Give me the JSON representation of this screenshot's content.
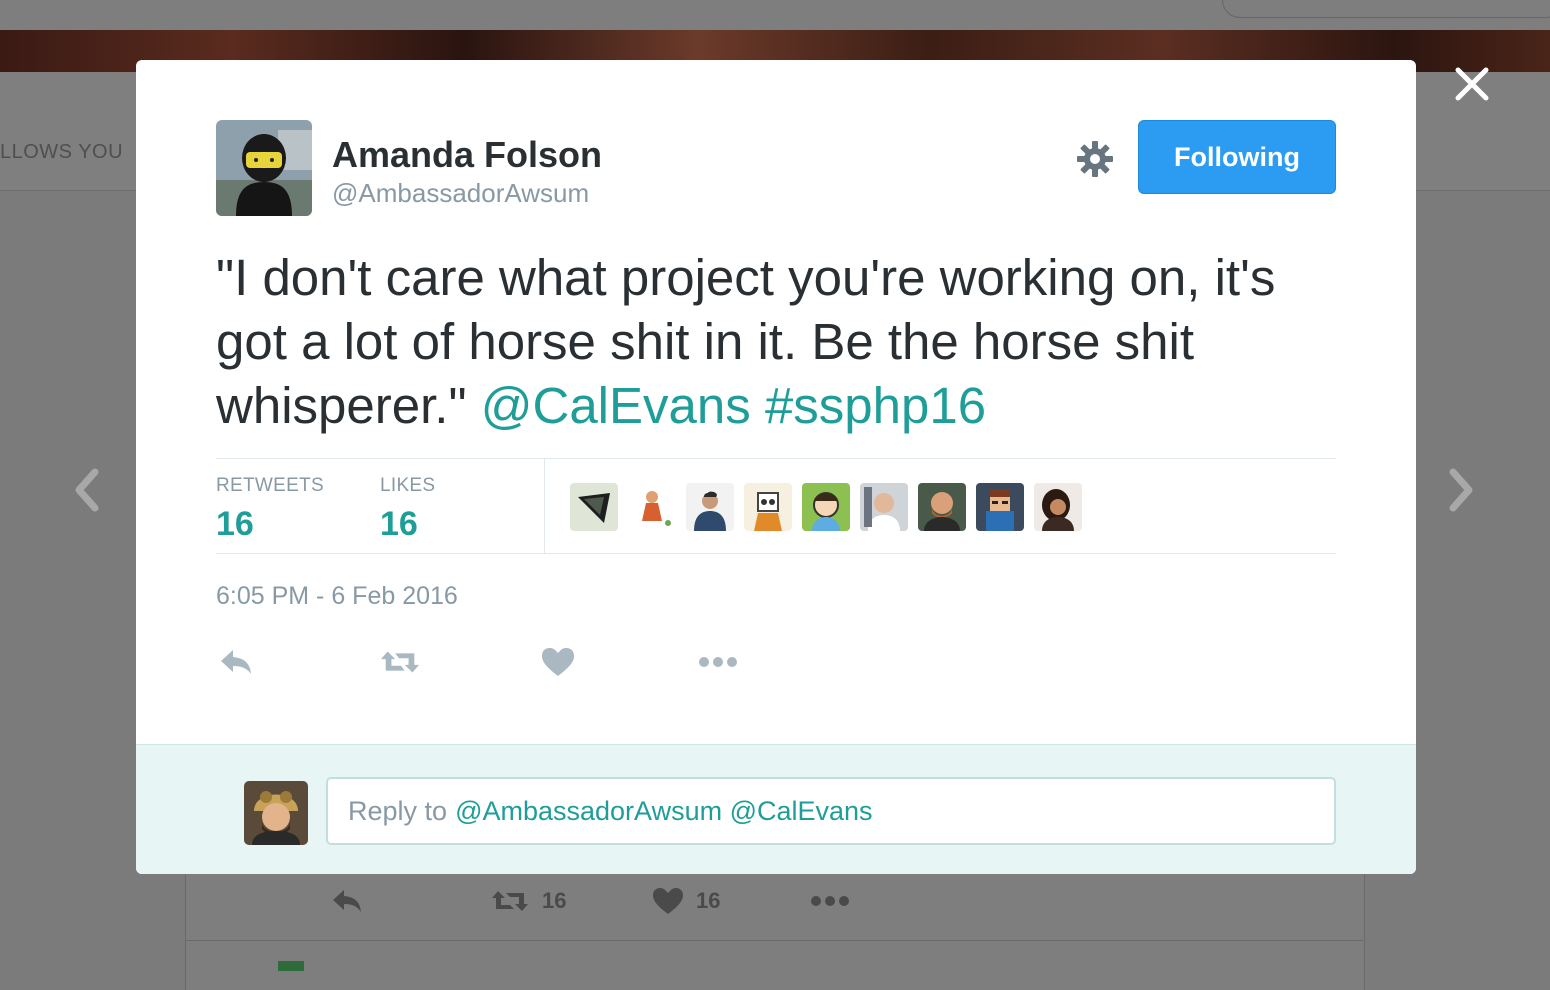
{
  "background": {
    "follows_you": "LLOWS YOU",
    "retweet_count": "16",
    "like_count": "16"
  },
  "tweet": {
    "author_name": "Amanda Folson",
    "author_handle": "@AmbassadorAwsum",
    "follow_button": "Following",
    "text_plain": "\"I don't care what project you're working on, it's got a lot of horse shit in it. Be the horse shit whisperer.\"",
    "mention": "@CalEvans",
    "hashtag": "#ssphp16",
    "stats": {
      "retweets_label": "RETWEETS",
      "retweets_value": "16",
      "likes_label": "LIKES",
      "likes_value": "16"
    },
    "timestamp": "6:05 PM - 6 Feb 2016",
    "liker_count": 9
  },
  "reply": {
    "placeholder_prefix": "Reply to",
    "mentions": "@AmbassadorAwsum @CalEvans"
  },
  "colors": {
    "accent": "#1f9e99",
    "follow_button": "#2b9cf2",
    "muted": "#8899a6",
    "text": "#292f33",
    "reply_bg": "#e8f5f5",
    "overlay": "#7b7b7b"
  },
  "icons": [
    "gear-icon",
    "close-icon",
    "chevron-left-icon",
    "chevron-right-icon",
    "reply-icon",
    "retweet-icon",
    "heart-icon",
    "more-icon"
  ]
}
